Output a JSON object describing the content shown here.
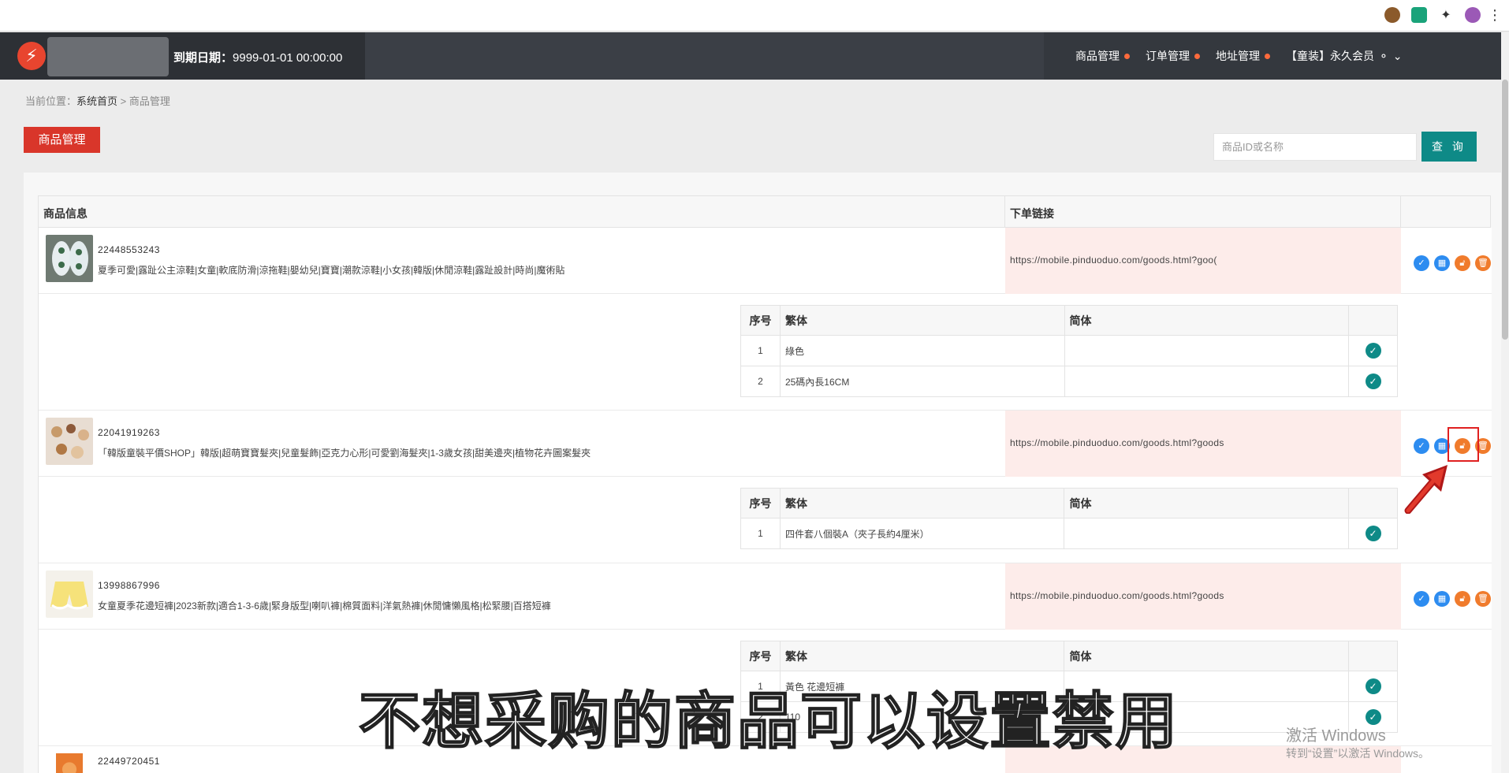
{
  "browser": {
    "extensions": [
      "cookie-icon",
      "green-extension-icon",
      "puzzle-icon",
      "side-panel-icon",
      "profile-avatar",
      "menu-dots-icon"
    ]
  },
  "header": {
    "logo_glyph": "⚡",
    "expiry_label": "到期日期：",
    "expiry_value": "9999-01-01 00:00:00",
    "nav": [
      {
        "label": "商品管理"
      },
      {
        "label": "订单管理"
      },
      {
        "label": "地址管理"
      }
    ],
    "member": "【童装】永久会员"
  },
  "breadcrumb": {
    "prefix": "当前位置：",
    "home": "系统首页",
    "separator": ">",
    "current": "商品管理"
  },
  "page_title": "商品管理",
  "search": {
    "placeholder": "商品ID或名称",
    "button": "查 询"
  },
  "table": {
    "headers": [
      "商品信息",
      "下单链接"
    ],
    "sub_headers": [
      "序号",
      "繁体",
      "简体"
    ],
    "products": [
      {
        "id": "22448553243",
        "title": "夏季可愛|露趾公主涼鞋|女童|軟底防滑|涼拖鞋|嬰幼兒|寶寶|潮款涼鞋|小女孩|韓版|休閒涼鞋|露趾設計|時尚|魔術貼",
        "link": "https://mobile.pinduoduo.com/goods.html?goo(",
        "variants": [
          {
            "no": "1",
            "trad": "綠色",
            "simp": ""
          },
          {
            "no": "2",
            "trad": "25碼內長16CM",
            "simp": ""
          }
        ]
      },
      {
        "id": "22041919263",
        "title": "「韓版童裝平價SHOP」韓版|超萌寶寶髮夾|兒童髮飾|亞克力心形|可愛劉海髮夾|1-3歲女孩|甜美邊夾|植物花卉圖案髮夾",
        "link": "https://mobile.pinduoduo.com/goods.html?goods",
        "variants": [
          {
            "no": "1",
            "trad": "四件套八個裝A（夾子長約4厘米）",
            "simp": ""
          }
        ]
      },
      {
        "id": "13998867996",
        "title": "女童夏季花邊短褲|2023新款|適合1-3-6歲|緊身版型|喇叭褲|棉質面料|洋氣熱褲|休閒慵懶風格|松緊腰|百搭短褲",
        "link": "https://mobile.pinduoduo.com/goods.html?goods",
        "variants": [
          {
            "no": "1",
            "trad": "黃色 花邊短褲",
            "simp": ""
          },
          {
            "no": "2",
            "trad": "110",
            "simp": ""
          }
        ]
      },
      {
        "id": "22449720451",
        "title": "",
        "link": ""
      }
    ],
    "actions": [
      "check-icon",
      "grid-icon",
      "lock-icon",
      "delete-icon"
    ]
  },
  "subtitle": "不想采购的商品可以设置禁用",
  "watermark": {
    "line1": "激活 Windows",
    "line2": "转到“设置”以激活 Windows。"
  },
  "colors": {
    "header_bg": "#3b3f46",
    "brand_red": "#d9362a",
    "teal": "#0e8a87",
    "action_blue": "#2d8cf0",
    "action_orange": "#f07b2c",
    "link_bg": "#fdecea"
  }
}
